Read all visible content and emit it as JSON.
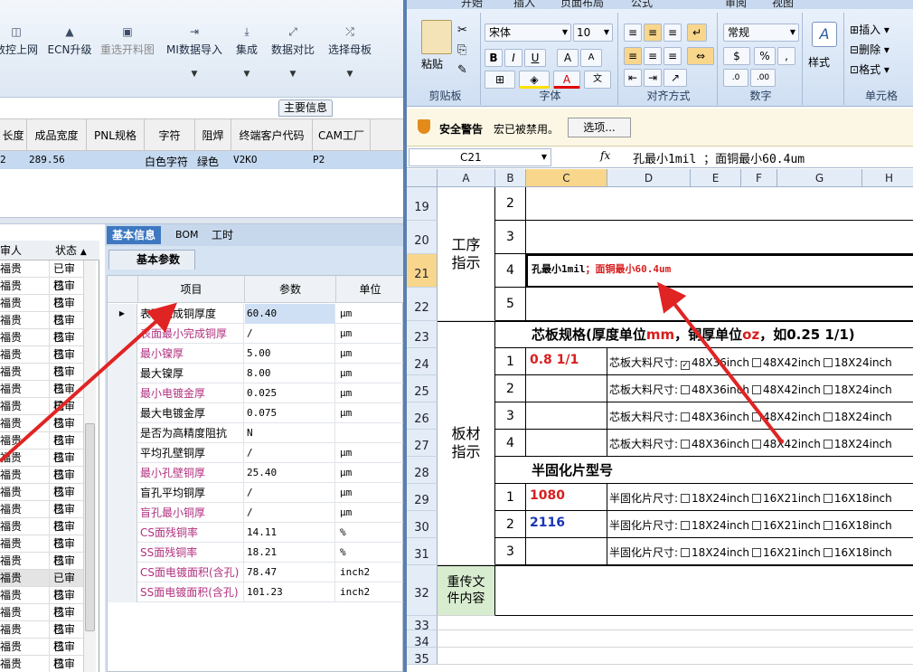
{
  "left_app": {
    "toolbar": [
      {
        "label": "数控上网",
        "icon": "network-icon",
        "disabled": false,
        "dropdown": false
      },
      {
        "label": "ECN升级",
        "icon": "upgrade-icon",
        "disabled": false,
        "dropdown": false
      },
      {
        "label": "重选开料图",
        "icon": "image-icon",
        "disabled": true,
        "dropdown": false
      },
      {
        "label": "MI数据导入",
        "icon": "import-icon",
        "disabled": false,
        "dropdown": true
      },
      {
        "label": "集成",
        "icon": "integrate-icon",
        "disabled": false,
        "dropdown": true
      },
      {
        "label": "数据对比",
        "icon": "compare-icon",
        "disabled": false,
        "dropdown": true
      },
      {
        "label": "选择母板",
        "icon": "shuffle-icon",
        "disabled": false,
        "dropdown": true
      }
    ],
    "main_info_tab": "主要信息",
    "columns": [
      "长度",
      "成品宽度",
      "PNL规格",
      "字符",
      "阻焊",
      "终端客户代码",
      "CAM工厂"
    ],
    "row": {
      "c0": "2",
      "c1": "289.56",
      "c3": "白色字符",
      "c4": "绿色",
      "c5": "V2KO",
      "c6": "P2"
    },
    "list_headers": {
      "reviewer": "审人",
      "status": "状态"
    },
    "list_rows": [
      {
        "name": "福贵",
        "status": "已审核"
      },
      {
        "name": "福贵",
        "status": "已审核"
      },
      {
        "name": "福贵",
        "status": "已审核"
      },
      {
        "name": "福贵",
        "status": "已审核"
      },
      {
        "name": "福贵",
        "status": "已审核"
      },
      {
        "name": "福贵",
        "status": "已审核"
      },
      {
        "name": "福贵",
        "status": "已审核"
      },
      {
        "name": "福贵",
        "status": "已审核"
      },
      {
        "name": "福贵",
        "status": "已审核"
      },
      {
        "name": "福贵",
        "status": "已审核"
      },
      {
        "name": "福贵",
        "status": "已审核"
      },
      {
        "name": "福贵",
        "status": "已审核"
      },
      {
        "name": "福贵",
        "status": "已审核"
      },
      {
        "name": "福贵",
        "status": "已审核"
      },
      {
        "name": "福贵",
        "status": "已审核"
      },
      {
        "name": "福贵",
        "status": "已审核"
      },
      {
        "name": "福贵",
        "status": "已审核"
      },
      {
        "name": "福贵",
        "status": "已审核"
      },
      {
        "name": "福贵",
        "status": "已审核"
      },
      {
        "name": "福贵",
        "status": "已审核"
      },
      {
        "name": "福贵",
        "status": "已审核"
      },
      {
        "name": "福贵",
        "status": "已审核"
      },
      {
        "name": "福贵",
        "status": "已审核"
      },
      {
        "name": "福贵",
        "status": "已审核"
      }
    ],
    "panel_tabs": [
      "基本信息",
      "BOM",
      "工时"
    ],
    "sub_tab": "基本参数",
    "param_headers": {
      "item": "项目",
      "param": "参数",
      "unit": "单位"
    },
    "params": [
      {
        "name": "表面完成铜厚度",
        "value": "60.40",
        "unit": "μm",
        "pink": false
      },
      {
        "name": "表面最小完成铜厚",
        "value": "/",
        "unit": "μm",
        "pink": true
      },
      {
        "name": "最小镍厚",
        "value": "5.00",
        "unit": "μm",
        "pink": true
      },
      {
        "name": "最大镍厚",
        "value": "8.00",
        "unit": "μm",
        "pink": false
      },
      {
        "name": "最小电镀金厚",
        "value": "0.025",
        "unit": "μm",
        "pink": true
      },
      {
        "name": "最大电镀金厚",
        "value": "0.075",
        "unit": "μm",
        "pink": false
      },
      {
        "name": "是否为高精度阻抗",
        "value": "N",
        "unit": "",
        "pink": false
      },
      {
        "name": "平均孔壁铜厚",
        "value": "/",
        "unit": "μm",
        "pink": false
      },
      {
        "name": "最小孔壁铜厚",
        "value": "25.40",
        "unit": "μm",
        "pink": true
      },
      {
        "name": "盲孔平均铜厚",
        "value": "/",
        "unit": "μm",
        "pink": false
      },
      {
        "name": "盲孔最小铜厚",
        "value": "/",
        "unit": "μm",
        "pink": true
      },
      {
        "name": "CS面残铜率",
        "value": "14.11",
        "unit": "%",
        "pink": true
      },
      {
        "name": "SS面残铜率",
        "value": "18.21",
        "unit": "%",
        "pink": true
      },
      {
        "name": "CS面电镀面积(含孔)",
        "value": "78.47",
        "unit": "inch2",
        "pink": true
      },
      {
        "name": "SS面电镀面积(含孔)",
        "value": "101.23",
        "unit": "inch2",
        "pink": true
      }
    ]
  },
  "excel": {
    "ribbon_tabs": [
      "开始",
      "插入",
      "页面布局",
      "公式",
      "审阅",
      "视图"
    ],
    "clipboard": {
      "paste": "粘贴",
      "group": "剪贴板"
    },
    "font": {
      "name": "宋体",
      "size": "10",
      "group": "字体",
      "bold": "B",
      "italic": "I",
      "underline": "U"
    },
    "align_group": "对齐方式",
    "number": {
      "format": "常规",
      "group": "数字",
      "percent": "%",
      "comma": ","
    },
    "styles": {
      "label": "样式"
    },
    "cells": {
      "insert": "插入",
      "delete": "删除",
      "format": "格式",
      "group": "单元格"
    },
    "security": {
      "title": "安全警告",
      "message": "宏已被禁用。",
      "options": "选项..."
    },
    "name_box": "C21",
    "fx": "fx",
    "formula": "孔最小1mil ；面铜最小60.4um",
    "columns": [
      "A",
      "B",
      "C",
      "D",
      "E",
      "F",
      "G",
      "H"
    ],
    "rows": [
      "19",
      "20",
      "21",
      "22",
      "23",
      "24",
      "25",
      "26",
      "27",
      "28",
      "29",
      "30",
      "31",
      "32",
      "33",
      "34",
      "35"
    ],
    "labels": {
      "process": "工序\n指示",
      "material": "板材\n指示",
      "reupload": "重传文\n件内容"
    },
    "b_values": {
      "r19": "2",
      "r20": "3",
      "r21": "4",
      "r22": "5",
      "r24": "1",
      "r25": "2",
      "r26": "3",
      "r27": "4",
      "r29": "1",
      "r30": "2",
      "r31": "3"
    },
    "c21_black": "孔最小1mil",
    "c21_red": "；面铜最小60.4um",
    "core_title_a": "芯板规格(厚度单位",
    "core_title_mm": "mm",
    "core_title_b": "，铜厚单位",
    "core_title_oz": "oz",
    "core_title_c": "，如0.25 1/1)",
    "c24": "0.8 1/1",
    "core_label": "芯板大料尺寸:",
    "core_opts": [
      "48X36inch",
      "48X42inch",
      "18X24inch"
    ],
    "pp_title": "半固化片型号",
    "c29": "1080",
    "c30": "2116",
    "pp_label": "半固化片尺寸:",
    "pp_opts": [
      "18X24inch",
      "16X21inch",
      "16X18inch"
    ],
    "colors": {
      "red": "#d81e1e",
      "blue": "#1b35b5",
      "arrow": "#e02424"
    }
  }
}
